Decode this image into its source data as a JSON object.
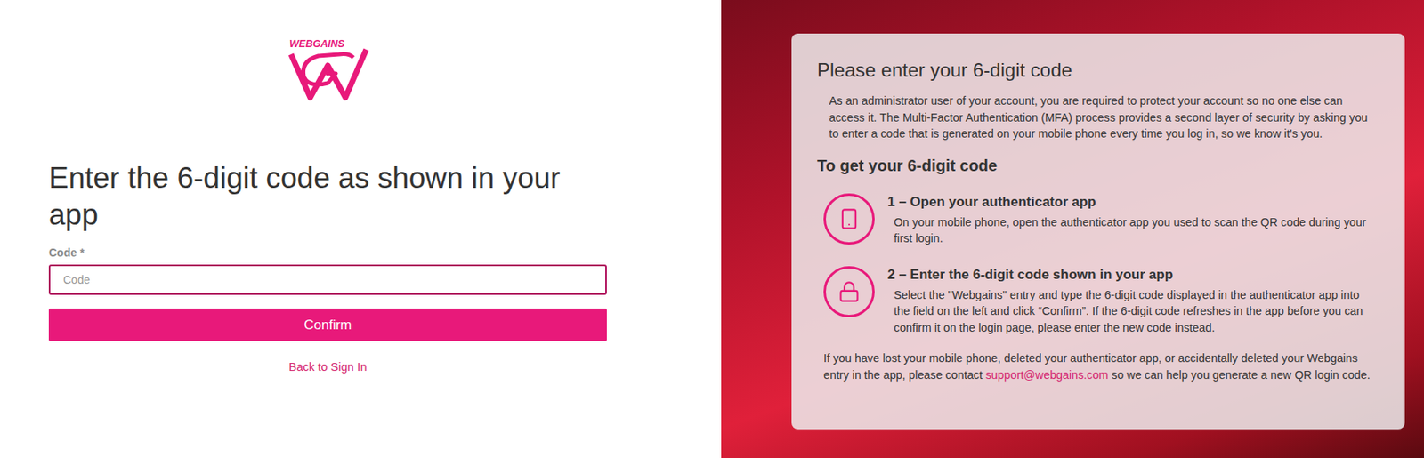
{
  "logo": {
    "text": "WEBGAINS"
  },
  "form": {
    "heading": "Enter the 6-digit code as shown in your app",
    "label": "Code *",
    "placeholder": "Code",
    "confirm": "Confirm",
    "back": "Back to Sign In"
  },
  "help": {
    "title": "Please enter your 6-digit code",
    "intro": "As an administrator user of your account, you are required to protect your account so no one else can access it. The Multi-Factor Authentication (MFA) process provides a second layer of security by asking you to enter a code that is generated on your mobile phone every time you log in, so we know it's you.",
    "subtitle": "To get your 6-digit code",
    "steps": [
      {
        "kind": "phone",
        "title": "1 – Open your authenticator app",
        "text": "On your mobile phone, open the authenticator app you used to scan the QR code during your first login."
      },
      {
        "kind": "lock",
        "title": "2 – Enter the 6-digit code shown in your app",
        "text": "Select the \"Webgains\" entry and type the 6-digit code displayed in the authenticator app into the field on the left and click “Confirm”. If the 6-digit code refreshes in the app before you can confirm it on the login page, please enter the new code instead."
      }
    ],
    "footer": {
      "before": "If you have lost your mobile phone, deleted your authenticator app, or accidentally deleted your Webgains entry in the app, please contact ",
      "link": "support@webgains.com",
      "after": " so we can help you generate a new QR login code."
    }
  }
}
